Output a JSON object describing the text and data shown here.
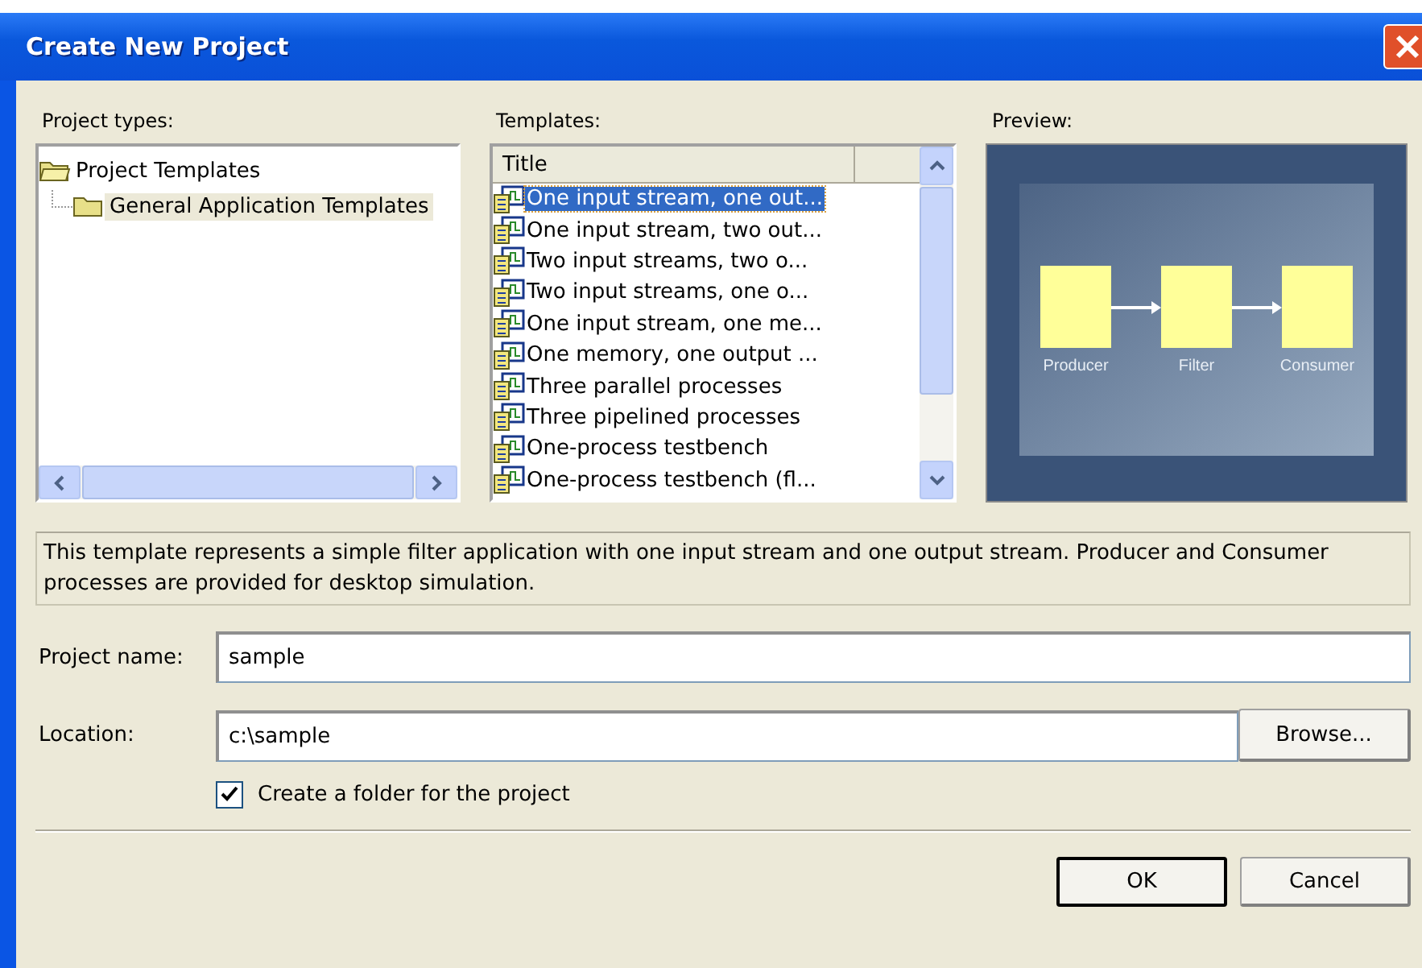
{
  "window": {
    "title": "Create New Project"
  },
  "project_types": {
    "label": "Project types:",
    "tree": [
      {
        "label": "Project Templates",
        "selected": false,
        "expanded": true,
        "children": [
          {
            "label": "General Application Templates",
            "selected": true
          }
        ]
      }
    ]
  },
  "templates": {
    "label": "Templates:",
    "column": "Title",
    "items": [
      {
        "label": "One input stream, one out...",
        "selected": true
      },
      {
        "label": "One input stream, two out...",
        "selected": false
      },
      {
        "label": "Two input streams, two o...",
        "selected": false
      },
      {
        "label": "Two input streams, one o...",
        "selected": false
      },
      {
        "label": "One input stream, one me...",
        "selected": false
      },
      {
        "label": "One memory, one output ...",
        "selected": false
      },
      {
        "label": "Three parallel processes",
        "selected": false
      },
      {
        "label": "Three pipelined processes",
        "selected": false
      },
      {
        "label": "One-process testbench",
        "selected": false
      },
      {
        "label": "One-process testbench (fl...",
        "selected": false
      }
    ]
  },
  "preview": {
    "label": "Preview:",
    "nodes": [
      "Producer",
      "Filter",
      "Consumer"
    ]
  },
  "description": "This template represents a simple filter application with one input stream and one output stream. Producer and Consumer processes are provided for desktop simulation.",
  "project_name": {
    "label": "Project name:",
    "value": "sample"
  },
  "location": {
    "label": "Location:",
    "value": "c:\\sample",
    "browse": "Browse..."
  },
  "create_folder": {
    "label": "Create a folder for the project",
    "checked": true
  },
  "buttons": [
    {
      "label": "OK",
      "kind": "default"
    },
    {
      "label": "Cancel",
      "kind": "normal"
    }
  ]
}
